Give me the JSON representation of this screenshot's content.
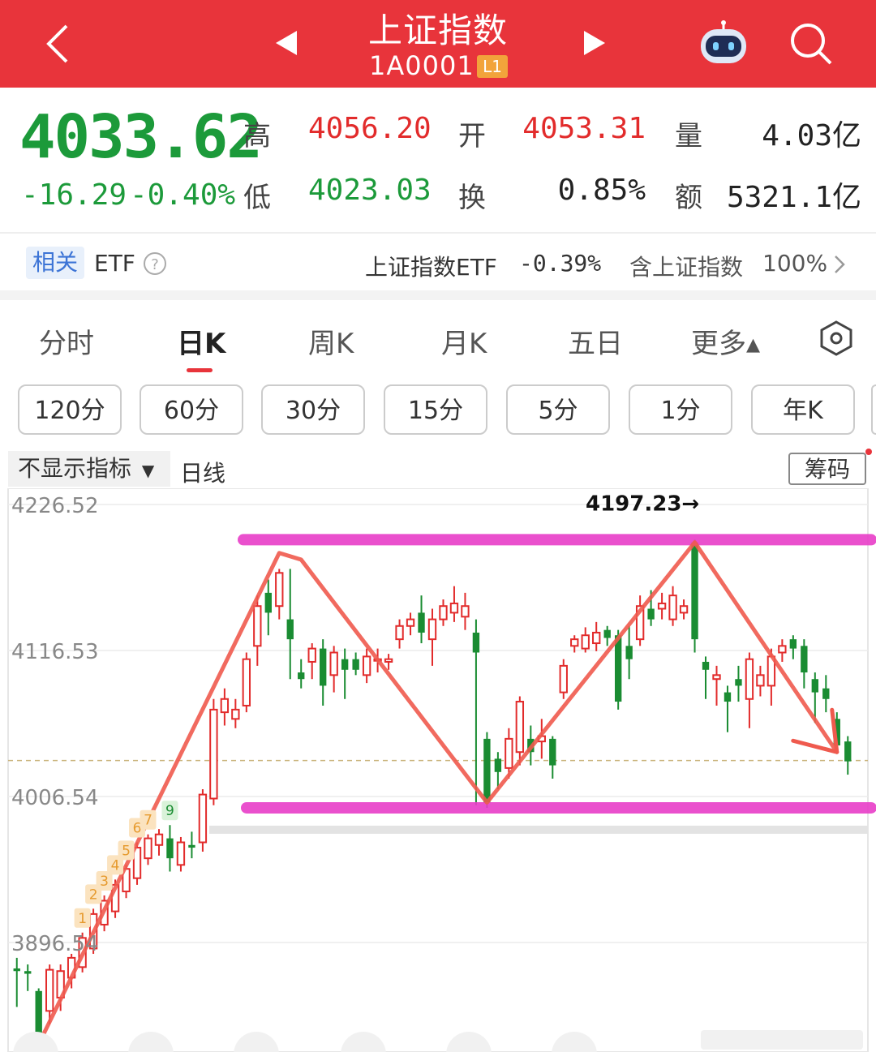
{
  "header": {
    "title": "上证指数",
    "code": "1A0001",
    "level_badge": "L1",
    "icons": [
      "back-arrow-icon",
      "prev-triangle-icon",
      "next-triangle-icon",
      "robot-assistant-icon",
      "search-icon"
    ]
  },
  "quote": {
    "price": "4033.62",
    "change": "-16.29",
    "change_pct": "-0.40%",
    "high_label": "高",
    "high": "4056.20",
    "open_label": "开",
    "open": "4053.31",
    "volume_label": "量",
    "volume": "4.03亿",
    "low_label": "低",
    "low": "4023.03",
    "turnover_label": "换",
    "turnover": "0.85%",
    "amount_label": "额",
    "amount": "5321.1亿"
  },
  "etf": {
    "tag": "相关",
    "label": "ETF",
    "fund_name": "上证指数ETF",
    "fund_change": "-0.39%",
    "contains": "含上证指数",
    "contains_pct": "100%"
  },
  "tabs": [
    {
      "label": "分时",
      "active": false
    },
    {
      "label": "日K",
      "active": true
    },
    {
      "label": "周K",
      "active": false
    },
    {
      "label": "月K",
      "active": false
    },
    {
      "label": "五日",
      "active": false
    },
    {
      "label": "更多▴",
      "active": false
    }
  ],
  "periods": [
    "120分",
    "60分",
    "30分",
    "15分",
    "5分",
    "1分",
    "年K"
  ],
  "indicator": {
    "selector": "不显示指标",
    "line_type": "日线",
    "chips_button": "筹码"
  },
  "chart_data": {
    "type": "candlestick",
    "y_ticks": [
      "4226.52",
      "4116.53",
      "4006.54",
      "3896.54"
    ],
    "ylim": [
      3866,
      4236
    ],
    "last_close": 4033.62,
    "annotation": "4197.23→",
    "sequence_labels": [
      "1",
      "2",
      "3",
      "4",
      "5",
      "6",
      "7",
      "9"
    ],
    "colors": {
      "up": "#e22b2b",
      "down": "#1a8c32",
      "trend": "#ef5a4e",
      "band": "#e83ec8"
    },
    "resistance_level": 4200,
    "support_level": 3998,
    "candles": [
      [
        3877,
        3875,
        3885,
        3848
      ],
      [
        3875,
        3873,
        3880,
        3860
      ],
      [
        3860,
        3826,
        3862,
        3810
      ],
      [
        3845,
        3876,
        3880,
        3835
      ],
      [
        3855,
        3875,
        3880,
        3845
      ],
      [
        3870,
        3885,
        3888,
        3862
      ],
      [
        3878,
        3900,
        3904,
        3874
      ],
      [
        3892,
        3918,
        3922,
        3888
      ],
      [
        3910,
        3928,
        3932,
        3905
      ],
      [
        3920,
        3940,
        3944,
        3915
      ],
      [
        3935,
        3952,
        3955,
        3930
      ],
      [
        3945,
        3968,
        3972,
        3940
      ],
      [
        3960,
        3975,
        3978,
        3955
      ],
      [
        3970,
        3978,
        3982,
        3962
      ],
      [
        3975,
        3960,
        3985,
        3950
      ],
      [
        3955,
        3972,
        3976,
        3950
      ],
      [
        3970,
        3968,
        3980,
        3960
      ],
      [
        3972,
        4008,
        4012,
        3965
      ],
      [
        4005,
        4072,
        4080,
        4000
      ],
      [
        4070,
        4080,
        4088,
        4060
      ],
      [
        4065,
        4072,
        4080,
        4058
      ],
      [
        4075,
        4110,
        4115,
        4070
      ],
      [
        4120,
        4150,
        4158,
        4105
      ],
      [
        4160,
        4145,
        4170,
        4128
      ],
      [
        4150,
        4175,
        4178,
        4140
      ],
      [
        4140,
        4125,
        4178,
        4095
      ],
      [
        4100,
        4095,
        4110,
        4088
      ],
      [
        4108,
        4118,
        4122,
        4095
      ],
      [
        4118,
        4090,
        4125,
        4075
      ],
      [
        4098,
        4115,
        4120,
        4085
      ],
      [
        4110,
        4102,
        4118,
        4080
      ],
      [
        4110,
        4102,
        4115,
        4098
      ],
      [
        4098,
        4112,
        4118,
        4092
      ],
      [
        4110,
        4110,
        4118,
        4100
      ],
      [
        4108,
        4110,
        4114,
        4102
      ],
      [
        4125,
        4135,
        4140,
        4118
      ],
      [
        4135,
        4140,
        4145,
        4128
      ],
      [
        4145,
        4130,
        4158,
        4122
      ],
      [
        4125,
        4140,
        4148,
        4105
      ],
      [
        4140,
        4150,
        4155,
        4135
      ],
      [
        4145,
        4152,
        4165,
        4138
      ],
      [
        4142,
        4150,
        4160,
        4132
      ],
      [
        4130,
        4115,
        4140,
        4000
      ],
      [
        4050,
        4002,
        4055,
        3998
      ],
      [
        4035,
        4025,
        4040,
        4012
      ],
      [
        4028,
        4050,
        4058,
        4020
      ],
      [
        4040,
        4078,
        4082,
        4030
      ],
      [
        4050,
        4040,
        4060,
        4030
      ],
      [
        4048,
        4052,
        4065,
        4035
      ],
      [
        4050,
        4030,
        4052,
        4020
      ],
      [
        4085,
        4105,
        4110,
        4080
      ],
      [
        4120,
        4125,
        4128,
        4115
      ],
      [
        4118,
        4128,
        4134,
        4115
      ],
      [
        4122,
        4130,
        4138,
        4116
      ],
      [
        4132,
        4126,
        4135,
        4120
      ],
      [
        4128,
        4078,
        4132,
        4072
      ],
      [
        4120,
        4110,
        4135,
        4095
      ],
      [
        4125,
        4150,
        4158,
        4120
      ],
      [
        4148,
        4140,
        4162,
        4135
      ],
      [
        4148,
        4152,
        4160,
        4140
      ],
      [
        4140,
        4158,
        4165,
        4135
      ],
      [
        4145,
        4150,
        4155,
        4140
      ],
      [
        4198,
        4125,
        4200,
        4115
      ],
      [
        4108,
        4102,
        4112,
        4080
      ],
      [
        4095,
        4098,
        4105,
        4075
      ],
      [
        4085,
        4078,
        4090,
        4055
      ],
      [
        4095,
        4090,
        4105,
        4078
      ],
      [
        4080,
        4110,
        4115,
        4058
      ],
      [
        4090,
        4098,
        4105,
        4082
      ],
      [
        4090,
        4112,
        4118,
        4075
      ],
      [
        4115,
        4120,
        4125,
        4108
      ],
      [
        4125,
        4118,
        4128,
        4110
      ],
      [
        4120,
        4100,
        4125,
        4088
      ],
      [
        4095,
        4085,
        4100,
        4062
      ],
      [
        4088,
        4080,
        4098,
        4070
      ],
      [
        4065,
        4045,
        4070,
        4040
      ],
      [
        4048,
        4033,
        4052,
        4023
      ]
    ]
  }
}
